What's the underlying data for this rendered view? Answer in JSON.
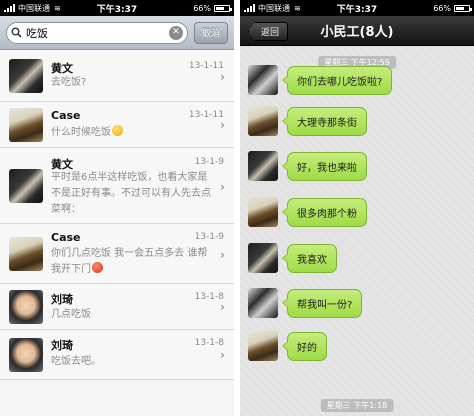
{
  "left_status": {
    "carrier": "中国联通",
    "wifi": "≋",
    "time": "下午3:37",
    "battery": "66%",
    "battery_level": 0.66
  },
  "right_status": {
    "carrier": "中国联通",
    "wifi": "≋",
    "time": "下午3:37",
    "battery": "66%",
    "battery_level": 0.66
  },
  "search": {
    "value": "吃饭",
    "cancel_label": "取消",
    "icon": "search-icon"
  },
  "results": [
    {
      "name": "黄文",
      "date": "13-1-11",
      "preview": "去吃饭?",
      "avatar": "huang"
    },
    {
      "name": "Case",
      "date": "13-1-11",
      "preview": "什么时候吃饭",
      "emoji": "smile",
      "avatar": "case"
    },
    {
      "name": "黄文",
      "date": "13-1-9",
      "preview": "平时是6点半这样吃饭，也看大家是不是正好有事。不过可以有人先去点菜啊：",
      "avatar": "huang"
    },
    {
      "name": "Case",
      "date": "13-1-9",
      "preview": "你们几点吃饭 我一会五点多去 谁帮我开下门",
      "emoji": "angry",
      "avatar": "case"
    },
    {
      "name": "刘琦",
      "date": "13-1-8",
      "preview": "几点吃饭",
      "avatar": "liu"
    },
    {
      "name": "刘琦",
      "date": "13-1-8",
      "preview": "吃饭去吧。",
      "avatar": "liu"
    }
  ],
  "chat": {
    "back_label": "返回",
    "title": "小民工(8人)",
    "timestamp_top": "星期三 下午12:59",
    "timestamp_bottom": "星期三 下午1:18",
    "messages": [
      {
        "text": "你们去哪儿吃饭啦?"
      },
      {
        "text": "大理寺那条街"
      },
      {
        "text": "好，我也来啦"
      },
      {
        "text": "很多肉那个粉"
      },
      {
        "text": "我喜欢"
      },
      {
        "text": "帮我叫一份?"
      },
      {
        "text": "好的"
      }
    ]
  }
}
